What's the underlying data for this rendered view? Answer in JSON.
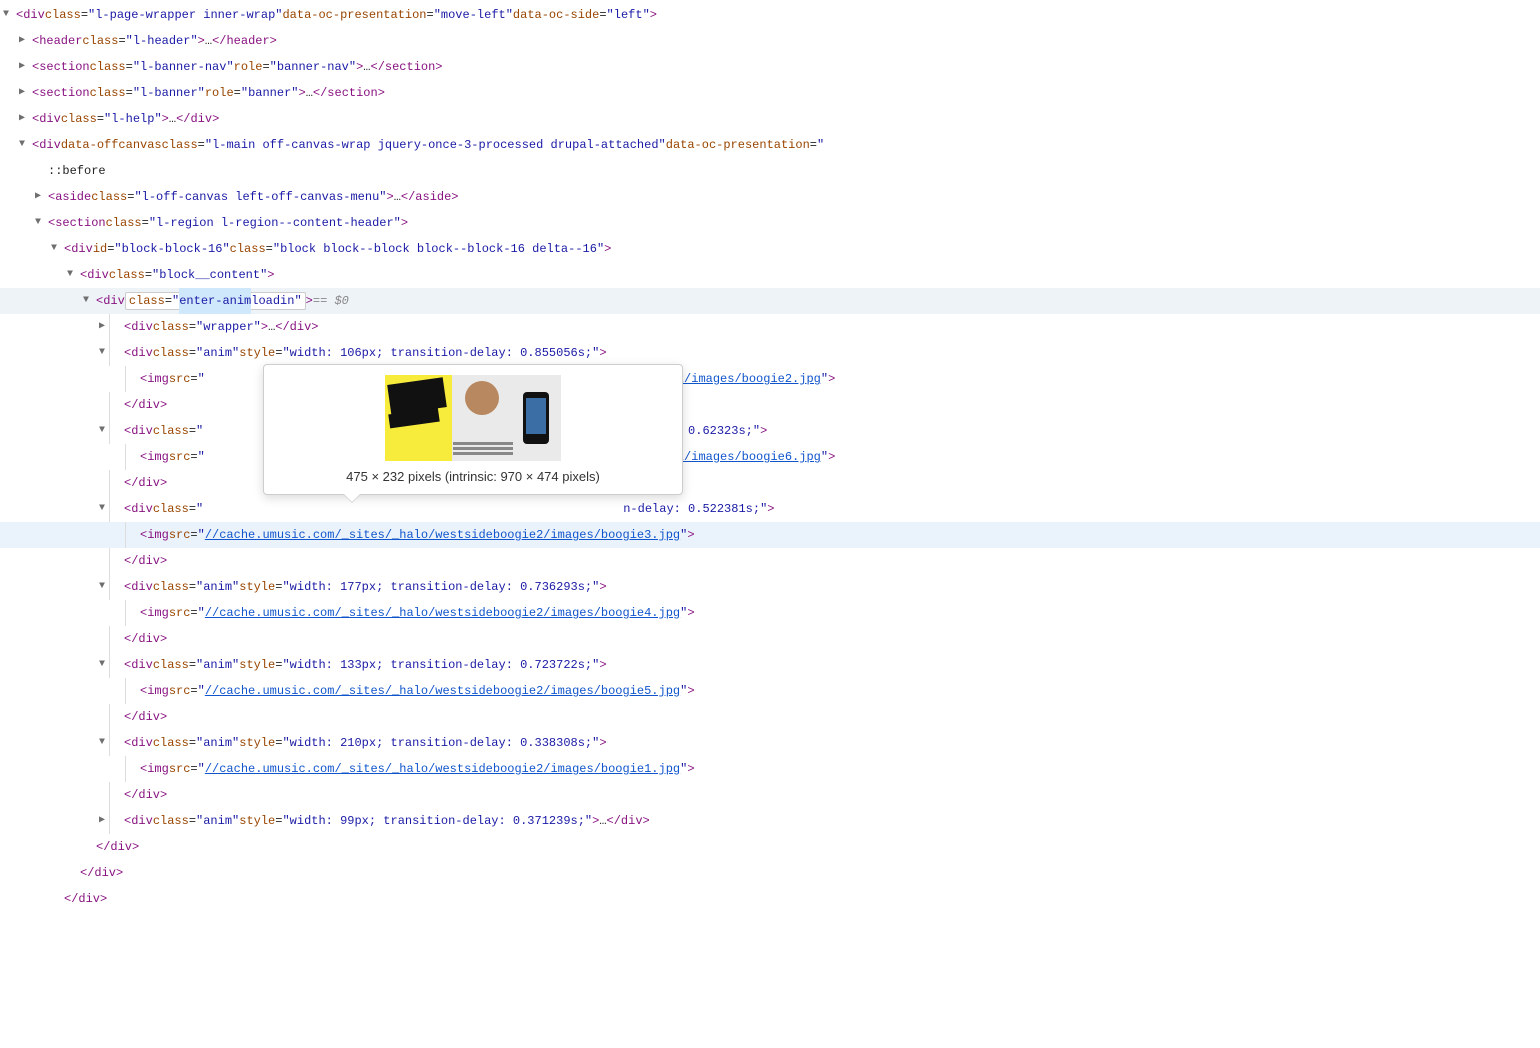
{
  "tooltip": {
    "dims": "475 × 232 pixels (intrinsic: 970 × 474 pixels)"
  },
  "sel": {
    "dollar": "== $0"
  },
  "pseudo": "::before",
  "lines": [
    {
      "indent": 0,
      "arrow": "▼",
      "parts": [
        {
          "t": "tag",
          "v": "<div "
        },
        {
          "t": "attr",
          "n": "class",
          "v": "l-page-wrapper inner-wrap"
        },
        {
          "t": "sp"
        },
        {
          "t": "attr",
          "n": "data-oc-presentation",
          "v": "move-left"
        },
        {
          "t": "sp"
        },
        {
          "t": "attr",
          "n": "data-oc-side",
          "v": "left"
        },
        {
          "t": "tag",
          "v": ">"
        }
      ]
    },
    {
      "indent": 1,
      "arrow": "▶",
      "parts": [
        {
          "t": "tag",
          "v": "<header "
        },
        {
          "t": "attr",
          "n": "class",
          "v": "l-header"
        },
        {
          "t": "tag",
          "v": ">"
        },
        {
          "t": "ellip",
          "v": "…"
        },
        {
          "t": "tag",
          "v": "</header>"
        }
      ]
    },
    {
      "indent": 1,
      "arrow": "▶",
      "parts": [
        {
          "t": "tag",
          "v": "<section "
        },
        {
          "t": "attr",
          "n": "class",
          "v": "l-banner-nav"
        },
        {
          "t": "sp"
        },
        {
          "t": "attr",
          "n": "role",
          "v": "banner-nav"
        },
        {
          "t": "tag",
          "v": ">"
        },
        {
          "t": "ellip",
          "v": "…"
        },
        {
          "t": "tag",
          "v": "</section>"
        }
      ]
    },
    {
      "indent": 1,
      "arrow": "▶",
      "parts": [
        {
          "t": "tag",
          "v": "<section "
        },
        {
          "t": "attr",
          "n": "class",
          "v": "l-banner"
        },
        {
          "t": "sp"
        },
        {
          "t": "attr",
          "n": "role",
          "v": "banner"
        },
        {
          "t": "tag",
          "v": ">"
        },
        {
          "t": "ellip",
          "v": "…"
        },
        {
          "t": "tag",
          "v": "</section>"
        }
      ]
    },
    {
      "indent": 1,
      "arrow": "▶",
      "parts": [
        {
          "t": "tag",
          "v": "<div "
        },
        {
          "t": "attr",
          "n": "class",
          "v": "l-help"
        },
        {
          "t": "tag",
          "v": ">"
        },
        {
          "t": "ellip",
          "v": "…"
        },
        {
          "t": "tag",
          "v": "</div>"
        }
      ]
    },
    {
      "indent": 1,
      "arrow": "▼",
      "parts": [
        {
          "t": "tag",
          "v": "<div "
        },
        {
          "t": "battr",
          "n": "data-offcanvas"
        },
        {
          "t": "sp"
        },
        {
          "t": "attr",
          "n": "class",
          "v": "l-main off-canvas-wrap jquery-once-3-processed drupal-attached"
        },
        {
          "t": "sp"
        },
        {
          "t": "attr",
          "n": "data-oc-presentation",
          "v": "",
          "trail": true
        }
      ]
    },
    {
      "indent": 2,
      "arrow": "",
      "parts": [
        {
          "t": "pseudo",
          "v": "::before"
        }
      ]
    },
    {
      "indent": 2,
      "arrow": "▶",
      "parts": [
        {
          "t": "tag",
          "v": "<aside "
        },
        {
          "t": "attr",
          "n": "class",
          "v": "l-off-canvas left-off-canvas-menu"
        },
        {
          "t": "tag",
          "v": ">"
        },
        {
          "t": "ellip",
          "v": "…"
        },
        {
          "t": "tag",
          "v": "</aside>"
        }
      ]
    },
    {
      "indent": 2,
      "arrow": "▼",
      "parts": [
        {
          "t": "tag",
          "v": "<section "
        },
        {
          "t": "attr",
          "n": "class",
          "v": "l-region l-region--content-header"
        },
        {
          "t": "tag",
          "v": ">"
        }
      ]
    },
    {
      "indent": 3,
      "arrow": "▼",
      "parts": [
        {
          "t": "tag",
          "v": "<div "
        },
        {
          "t": "attr",
          "n": "id",
          "v": "block-block-16"
        },
        {
          "t": "sp"
        },
        {
          "t": "attr",
          "n": "class",
          "v": "block block--block block--block-16 delta--16"
        },
        {
          "t": "tag",
          "v": ">"
        }
      ]
    },
    {
      "indent": 4,
      "arrow": "▼",
      "parts": [
        {
          "t": "tag",
          "v": "<div "
        },
        {
          "t": "attr",
          "n": "class",
          "v": "block__content"
        },
        {
          "t": "tag",
          "v": ">"
        }
      ]
    },
    {
      "indent": 5,
      "arrow": "▼",
      "selected": true,
      "parts": [
        {
          "t": "tag",
          "v": "<div "
        },
        {
          "t": "selbox",
          "n": "class",
          "v": "enter-anim loadin",
          "hl": "enter-anim"
        },
        {
          "t": "tag",
          "v": ">"
        },
        {
          "t": "sp"
        },
        {
          "t": "sp"
        },
        {
          "t": "dollar",
          "v": "== $0"
        }
      ]
    },
    {
      "indent": 6,
      "arrow": "▶",
      "guides": 1,
      "parts": [
        {
          "t": "tag",
          "v": "<div "
        },
        {
          "t": "attr",
          "n": "class",
          "v": "wrapper"
        },
        {
          "t": "tag",
          "v": ">"
        },
        {
          "t": "ellip",
          "v": "…"
        },
        {
          "t": "tag",
          "v": "</div>"
        }
      ]
    },
    {
      "indent": 6,
      "arrow": "▼",
      "guides": 1,
      "parts": [
        {
          "t": "tag",
          "v": "<div "
        },
        {
          "t": "attr",
          "n": "class",
          "v": "anim"
        },
        {
          "t": "sp"
        },
        {
          "t": "attr",
          "n": "style",
          "v": "width: 106px; transition-delay: 0.855056s;"
        },
        {
          "t": "tag",
          "v": ">"
        }
      ]
    },
    {
      "indent": 7,
      "arrow": "",
      "guides": 1,
      "parts": [
        {
          "t": "tag",
          "v": "<img "
        },
        {
          "t": "attrname",
          "v": "src"
        },
        {
          "t": "eq",
          "v": "="
        },
        {
          "t": "covered",
          "right": "sideboogie2/images/boogie2.jpg"
        },
        {
          "t": "tag",
          "v": ">"
        }
      ]
    },
    {
      "indent": 6,
      "arrow": "",
      "guides": 1,
      "parts": [
        {
          "t": "tag",
          "v": "</div>"
        }
      ]
    },
    {
      "indent": 6,
      "arrow": "▼",
      "guides": 1,
      "parts": [
        {
          "t": "tag",
          "v": "<div "
        },
        {
          "t": "attrname",
          "v": "class"
        },
        {
          "t": "eq",
          "v": "="
        },
        {
          "t": "coveredmid",
          "right": "n-delay: 0.62323s;"
        },
        {
          "t": "quote",
          "v": "\""
        },
        {
          "t": "tag",
          "v": ">"
        }
      ]
    },
    {
      "indent": 7,
      "arrow": "",
      "guides": 1,
      "parts": [
        {
          "t": "tag",
          "v": "<img "
        },
        {
          "t": "attrname",
          "v": "src"
        },
        {
          "t": "eq",
          "v": "="
        },
        {
          "t": "covered",
          "right": "sideboogie2/images/boogie6.jpg"
        },
        {
          "t": "tag",
          "v": ">"
        }
      ]
    },
    {
      "indent": 6,
      "arrow": "",
      "guides": 1,
      "parts": [
        {
          "t": "tag",
          "v": "</div>"
        }
      ]
    },
    {
      "indent": 6,
      "arrow": "▼",
      "guides": 1,
      "parts": [
        {
          "t": "tag",
          "v": "<div "
        },
        {
          "t": "attrname",
          "v": "class"
        },
        {
          "t": "eq",
          "v": "="
        },
        {
          "t": "coveredmid2",
          "right": "n-delay: 0.522381s;"
        },
        {
          "t": "quote",
          "v": "\""
        },
        {
          "t": "tag",
          "v": ">"
        }
      ]
    },
    {
      "indent": 7,
      "arrow": "",
      "guides": 1,
      "hover": true,
      "parts": [
        {
          "t": "tag",
          "v": "<img "
        },
        {
          "t": "attrname",
          "v": "src"
        },
        {
          "t": "eq",
          "v": "="
        },
        {
          "t": "quote",
          "v": "\""
        },
        {
          "t": "link",
          "v": "//cache.umusic.com/_sites/_halo/westsideboogie2/images/boogie3.jpg"
        },
        {
          "t": "quote",
          "v": "\""
        },
        {
          "t": "tag",
          "v": ">"
        }
      ]
    },
    {
      "indent": 6,
      "arrow": "",
      "guides": 1,
      "parts": [
        {
          "t": "tag",
          "v": "</div>"
        }
      ]
    },
    {
      "indent": 6,
      "arrow": "▼",
      "guides": 1,
      "parts": [
        {
          "t": "tag",
          "v": "<div "
        },
        {
          "t": "attr",
          "n": "class",
          "v": "anim"
        },
        {
          "t": "sp"
        },
        {
          "t": "attr",
          "n": "style",
          "v": "width: 177px; transition-delay: 0.736293s;"
        },
        {
          "t": "tag",
          "v": ">"
        }
      ]
    },
    {
      "indent": 7,
      "arrow": "",
      "guides": 1,
      "parts": [
        {
          "t": "tag",
          "v": "<img "
        },
        {
          "t": "attrname",
          "v": "src"
        },
        {
          "t": "eq",
          "v": "="
        },
        {
          "t": "quote",
          "v": "\""
        },
        {
          "t": "link",
          "v": "//cache.umusic.com/_sites/_halo/westsideboogie2/images/boogie4.jpg"
        },
        {
          "t": "quote",
          "v": "\""
        },
        {
          "t": "tag",
          "v": ">"
        }
      ]
    },
    {
      "indent": 6,
      "arrow": "",
      "guides": 1,
      "parts": [
        {
          "t": "tag",
          "v": "</div>"
        }
      ]
    },
    {
      "indent": 6,
      "arrow": "▼",
      "guides": 1,
      "parts": [
        {
          "t": "tag",
          "v": "<div "
        },
        {
          "t": "attr",
          "n": "class",
          "v": "anim"
        },
        {
          "t": "sp"
        },
        {
          "t": "attr",
          "n": "style",
          "v": "width: 133px; transition-delay: 0.723722s;"
        },
        {
          "t": "tag",
          "v": ">"
        }
      ]
    },
    {
      "indent": 7,
      "arrow": "",
      "guides": 1,
      "parts": [
        {
          "t": "tag",
          "v": "<img "
        },
        {
          "t": "attrname",
          "v": "src"
        },
        {
          "t": "eq",
          "v": "="
        },
        {
          "t": "quote",
          "v": "\""
        },
        {
          "t": "link",
          "v": "//cache.umusic.com/_sites/_halo/westsideboogie2/images/boogie5.jpg"
        },
        {
          "t": "quote",
          "v": "\""
        },
        {
          "t": "tag",
          "v": ">"
        }
      ]
    },
    {
      "indent": 6,
      "arrow": "",
      "guides": 1,
      "parts": [
        {
          "t": "tag",
          "v": "</div>"
        }
      ]
    },
    {
      "indent": 6,
      "arrow": "▼",
      "guides": 1,
      "parts": [
        {
          "t": "tag",
          "v": "<div "
        },
        {
          "t": "attr",
          "n": "class",
          "v": "anim"
        },
        {
          "t": "sp"
        },
        {
          "t": "attr",
          "n": "style",
          "v": "width: 210px; transition-delay: 0.338308s;"
        },
        {
          "t": "tag",
          "v": ">"
        }
      ]
    },
    {
      "indent": 7,
      "arrow": "",
      "guides": 1,
      "parts": [
        {
          "t": "tag",
          "v": "<img "
        },
        {
          "t": "attrname",
          "v": "src"
        },
        {
          "t": "eq",
          "v": "="
        },
        {
          "t": "quote",
          "v": "\""
        },
        {
          "t": "link",
          "v": "//cache.umusic.com/_sites/_halo/westsideboogie2/images/boogie1.jpg"
        },
        {
          "t": "quote",
          "v": "\""
        },
        {
          "t": "tag",
          "v": ">"
        }
      ]
    },
    {
      "indent": 6,
      "arrow": "",
      "guides": 1,
      "parts": [
        {
          "t": "tag",
          "v": "</div>"
        }
      ]
    },
    {
      "indent": 6,
      "arrow": "▶",
      "guides": 1,
      "parts": [
        {
          "t": "tag",
          "v": "<div "
        },
        {
          "t": "attr",
          "n": "class",
          "v": "anim"
        },
        {
          "t": "sp"
        },
        {
          "t": "attr",
          "n": "style",
          "v": "width: 99px; transition-delay: 0.371239s;"
        },
        {
          "t": "tag",
          "v": ">"
        },
        {
          "t": "ellip",
          "v": "…"
        },
        {
          "t": "tag",
          "v": "</div>"
        }
      ]
    },
    {
      "indent": 5,
      "arrow": "",
      "parts": [
        {
          "t": "tag",
          "v": "</div>"
        }
      ]
    },
    {
      "indent": 4,
      "arrow": "",
      "parts": [
        {
          "t": "tag",
          "v": "</div>"
        }
      ]
    },
    {
      "indent": 3,
      "arrow": "",
      "parts": [
        {
          "t": "tag",
          "v": "</div>"
        }
      ]
    }
  ]
}
